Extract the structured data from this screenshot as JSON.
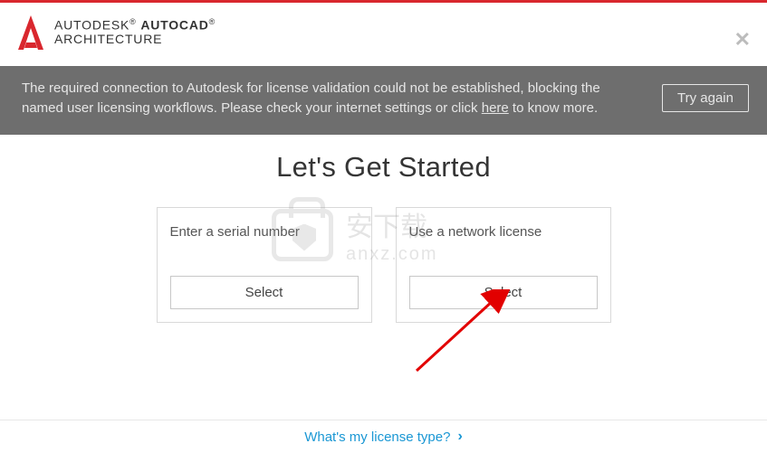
{
  "header": {
    "brand": "AUTODESK",
    "reg": "®",
    "product": "AUTOCAD",
    "product_reg": "®",
    "subline": "ARCHITECTURE"
  },
  "banner": {
    "text_part1": "The required connection to Autodesk for license validation could not be established, blocking the named user licensing workflows. Please check your internet settings or click ",
    "here": "here",
    "text_part2": " to know more.",
    "try_again": "Try again"
  },
  "main": {
    "title": "Let's Get Started",
    "card1_label": "Enter a serial number",
    "card1_button": "Select",
    "card2_label": "Use a network license",
    "card2_button": "Select"
  },
  "footer": {
    "link": "What's my license type?",
    "chevron": "›"
  },
  "watermark": {
    "brand": "安下载",
    "domain": "anxz.com"
  }
}
